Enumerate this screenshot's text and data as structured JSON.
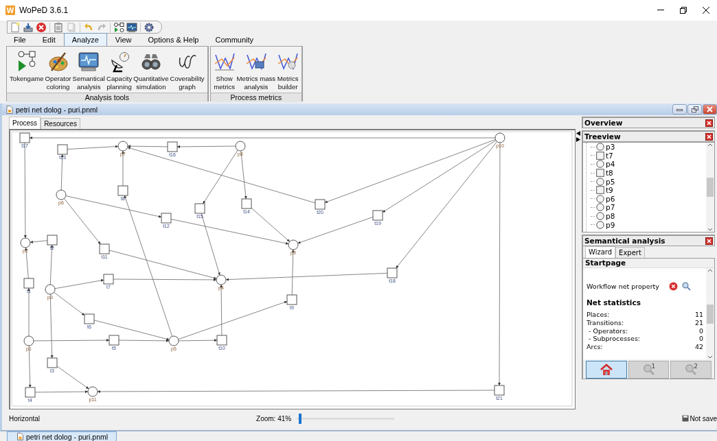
{
  "window": {
    "logo_letter": "W",
    "title": "WoPeD 3.6.1"
  },
  "menu_tabs": [
    {
      "label": "File",
      "selected": false
    },
    {
      "label": "Edit",
      "selected": false
    },
    {
      "label": "Analyze",
      "selected": true
    },
    {
      "label": "View",
      "selected": false
    },
    {
      "label": "Options & Help",
      "selected": false
    },
    {
      "label": "Community",
      "selected": false
    }
  ],
  "ribbon_groups": [
    {
      "title": "Analysis tools",
      "buttons": [
        {
          "kind": "tokengame",
          "label": "Tokengame"
        },
        {
          "kind": "palette",
          "label": "Operator\ncoloring"
        },
        {
          "kind": "monitor",
          "label": "Semantical\nanalysis"
        },
        {
          "kind": "dish",
          "label": "Capacity\nplanning"
        },
        {
          "kind": "binoculars",
          "label": "Quantitative\nsimulation"
        },
        {
          "kind": "curve",
          "label": "Coverability\ngraph"
        }
      ]
    },
    {
      "title": "Process metrics",
      "buttons": [
        {
          "kind": "metrics",
          "label": "Show\nmetrics"
        },
        {
          "kind": "metrics-mass",
          "label": "Metrics mass\nanalysis"
        },
        {
          "kind": "metrics-builder",
          "label": "Metrics\nbuilder"
        }
      ]
    }
  ],
  "document": {
    "title": "petri net dolog - puri.pnml",
    "tabs": [
      {
        "label": "Process",
        "selected": true
      },
      {
        "label": "Resources",
        "selected": false
      }
    ],
    "net_nodes": [
      {
        "kind": "transition",
        "label": "t17"
      },
      {
        "kind": "transition",
        "label": "t13"
      },
      {
        "kind": "place",
        "label": "p7"
      },
      {
        "kind": "transition",
        "label": "t16"
      },
      {
        "kind": "place",
        "label": "p8"
      },
      {
        "kind": "place",
        "label": "p10"
      },
      {
        "kind": "place",
        "label": "p6"
      },
      {
        "kind": "transition",
        "label": "t8"
      },
      {
        "kind": "transition",
        "label": "t15"
      },
      {
        "kind": "transition",
        "label": "t14"
      },
      {
        "kind": "transition",
        "label": "t12"
      },
      {
        "kind": "transition",
        "label": "t20"
      },
      {
        "kind": "transition",
        "label": "t19"
      },
      {
        "kind": "place",
        "label": "p2"
      },
      {
        "kind": "transition",
        "label": "t2"
      },
      {
        "kind": "transition",
        "label": "t11"
      },
      {
        "kind": "place",
        "label": "p9"
      },
      {
        "kind": "transition",
        "label": "t1"
      },
      {
        "kind": "place",
        "label": "p3"
      },
      {
        "kind": "transition",
        "label": "t7"
      },
      {
        "kind": "place",
        "label": "p4"
      },
      {
        "kind": "transition",
        "label": "t18"
      },
      {
        "kind": "transition",
        "label": "t9"
      },
      {
        "kind": "transition",
        "label": "t6"
      },
      {
        "kind": "place",
        "label": "p1"
      },
      {
        "kind": "transition",
        "label": "t5"
      },
      {
        "kind": "place",
        "label": "p5"
      },
      {
        "kind": "transition",
        "label": "t10"
      },
      {
        "kind": "transition",
        "label": "t3"
      },
      {
        "kind": "transition",
        "label": "t4"
      },
      {
        "kind": "place",
        "label": "p11"
      },
      {
        "kind": "transition",
        "label": "t21"
      }
    ]
  },
  "overview": {
    "title": "Overview"
  },
  "treeview": {
    "title": "Treeview",
    "items": [
      {
        "kind": "place",
        "label": "p3"
      },
      {
        "kind": "transition",
        "label": "t7"
      },
      {
        "kind": "place",
        "label": "p4"
      },
      {
        "kind": "transition",
        "label": "t8"
      },
      {
        "kind": "place",
        "label": "p5"
      },
      {
        "kind": "transition",
        "label": "t9"
      },
      {
        "kind": "place",
        "label": "p6"
      },
      {
        "kind": "place",
        "label": "p7"
      },
      {
        "kind": "place",
        "label": "p8"
      },
      {
        "kind": "place",
        "label": "p9"
      }
    ]
  },
  "semantical_analysis": {
    "title": "Semantical analysis",
    "tabs": [
      {
        "label": "Wizard",
        "selected": true
      },
      {
        "label": "Expert",
        "selected": false
      }
    ],
    "section": "Startpage",
    "property": {
      "label": "Workflow net property",
      "passed": false
    },
    "statistics_title": "Net statistics",
    "statistics": [
      {
        "label": "Places:",
        "value": "11"
      },
      {
        "label": "Transitions:",
        "value": "21"
      },
      {
        "label": " - Operators:",
        "value": "0"
      },
      {
        "label": " - Subprocesses:",
        "value": "0"
      },
      {
        "label": "Arcs:",
        "value": "42"
      }
    ],
    "nav_buttons": [
      {
        "kind": "home",
        "selected": true,
        "disabled": false
      },
      {
        "kind": "search",
        "badge": "1",
        "selected": false,
        "disabled": true
      },
      {
        "kind": "search",
        "badge": "2",
        "selected": false,
        "disabled": true
      }
    ]
  },
  "status_bar": {
    "orientation": "Horizontal",
    "zoom": "Zoom: 41%",
    "zoom_slider": {
      "level": 0.02
    },
    "save_state": "Not save"
  },
  "taskbar": {
    "items": [
      {
        "label": "petri net dolog - puri.pnml",
        "selected": true
      }
    ]
  }
}
